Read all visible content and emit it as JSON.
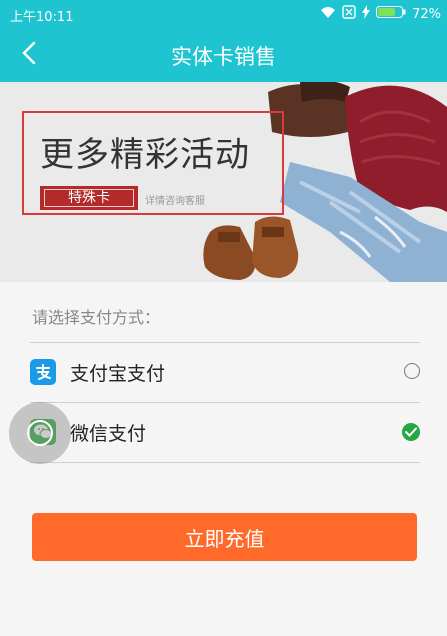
{
  "status_bar": {
    "time": "上午10:11",
    "battery": "72%",
    "icons": [
      "wifi-icon",
      "sim-x-icon",
      "charging-icon",
      "battery-icon"
    ]
  },
  "nav": {
    "title": "实体卡销售",
    "back_icon": "back-icon"
  },
  "banner": {
    "headline": "更多精彩活动",
    "tag": "特殊卡",
    "note": "详情咨询客服"
  },
  "payment": {
    "prompt": "请选择支付方式：",
    "options": [
      {
        "label": "支付宝支付",
        "icon": "alipay-icon",
        "selected": false
      },
      {
        "label": "微信支付",
        "icon": "wechat-icon",
        "selected": true
      }
    ]
  },
  "submit": {
    "label": "立即充值"
  },
  "colors": {
    "header": "#1fc4d1",
    "button": "#ff6a2b",
    "check": "#27a744",
    "alipay": "#1c9ae8",
    "wechat": "#2aae3f"
  }
}
